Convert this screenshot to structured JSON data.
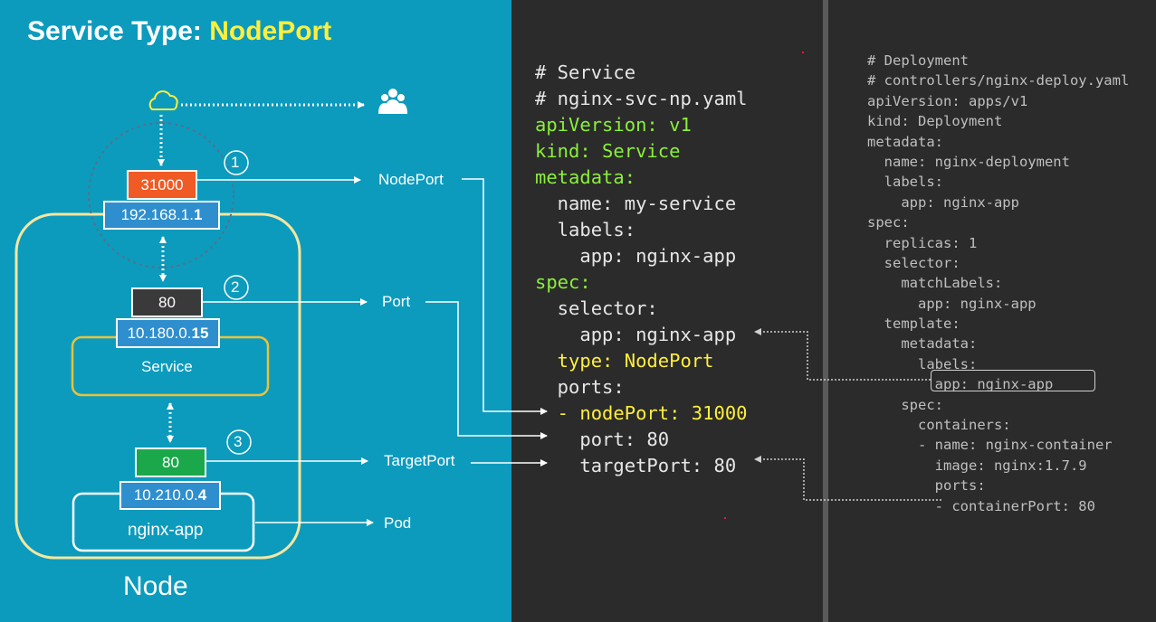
{
  "title": {
    "prefix": "Service Type: ",
    "highlight": "NodePort"
  },
  "diagram": {
    "node_port_value": "31000",
    "node_ip": {
      "prefix": "192.168.1.",
      "suffix": "1"
    },
    "service_port_value": "80",
    "service_ip": {
      "prefix": "10.180.0.",
      "suffix": "15"
    },
    "service_label": "Service",
    "target_port_value": "80",
    "pod_ip": {
      "prefix": "10.210.0.",
      "suffix": "4"
    },
    "pod_label": "nginx-app",
    "node_label": "Node",
    "step_1": "1",
    "step_2": "2",
    "step_3": "3",
    "callouts": {
      "nodeport": "NodePort",
      "port": "Port",
      "targetport": "TargetPort",
      "pod": "Pod"
    },
    "icons": {
      "cloud": "cloud-icon",
      "users": "users-icon"
    },
    "colors": {
      "background": "#0c9bbd",
      "node_port": "#f05a24",
      "port": "#3a3a3a",
      "target_port": "#1aa84a",
      "ip_box": "#2f8fce",
      "node_outline": "#f5e6a0",
      "service_outline": "#e8c23a",
      "highlight": "#ffef3c"
    }
  },
  "service_yaml": [
    "# Service",
    "# nginx-svc-np.yaml",
    "apiVersion: v1",
    "kind: Service",
    "metadata:",
    "  name: my-service",
    "  labels:",
    "    app: nginx-app",
    "spec:",
    "  selector:",
    "    app: nginx-app",
    "  type: NodePort",
    "  ports:",
    "  - nodePort: 31000",
    "    port: 80",
    "    targetPort: 80"
  ],
  "deployment_yaml": [
    "# Deployment",
    "# controllers/nginx-deploy.yaml",
    "apiVersion: apps/v1",
    "kind: Deployment",
    "metadata:",
    "  name: nginx-deployment",
    "  labels:",
    "    app: nginx-app",
    "spec:",
    "  replicas: 1",
    "  selector:",
    "    matchLabels:",
    "      app: nginx-app",
    "  template:",
    "    metadata:",
    "      labels:",
    "        app: nginx-app",
    "    spec:",
    "      containers:",
    "      - name: nginx-container",
    "        image: nginx:1.7.9",
    "        ports:",
    "        - containerPort: 80"
  ]
}
